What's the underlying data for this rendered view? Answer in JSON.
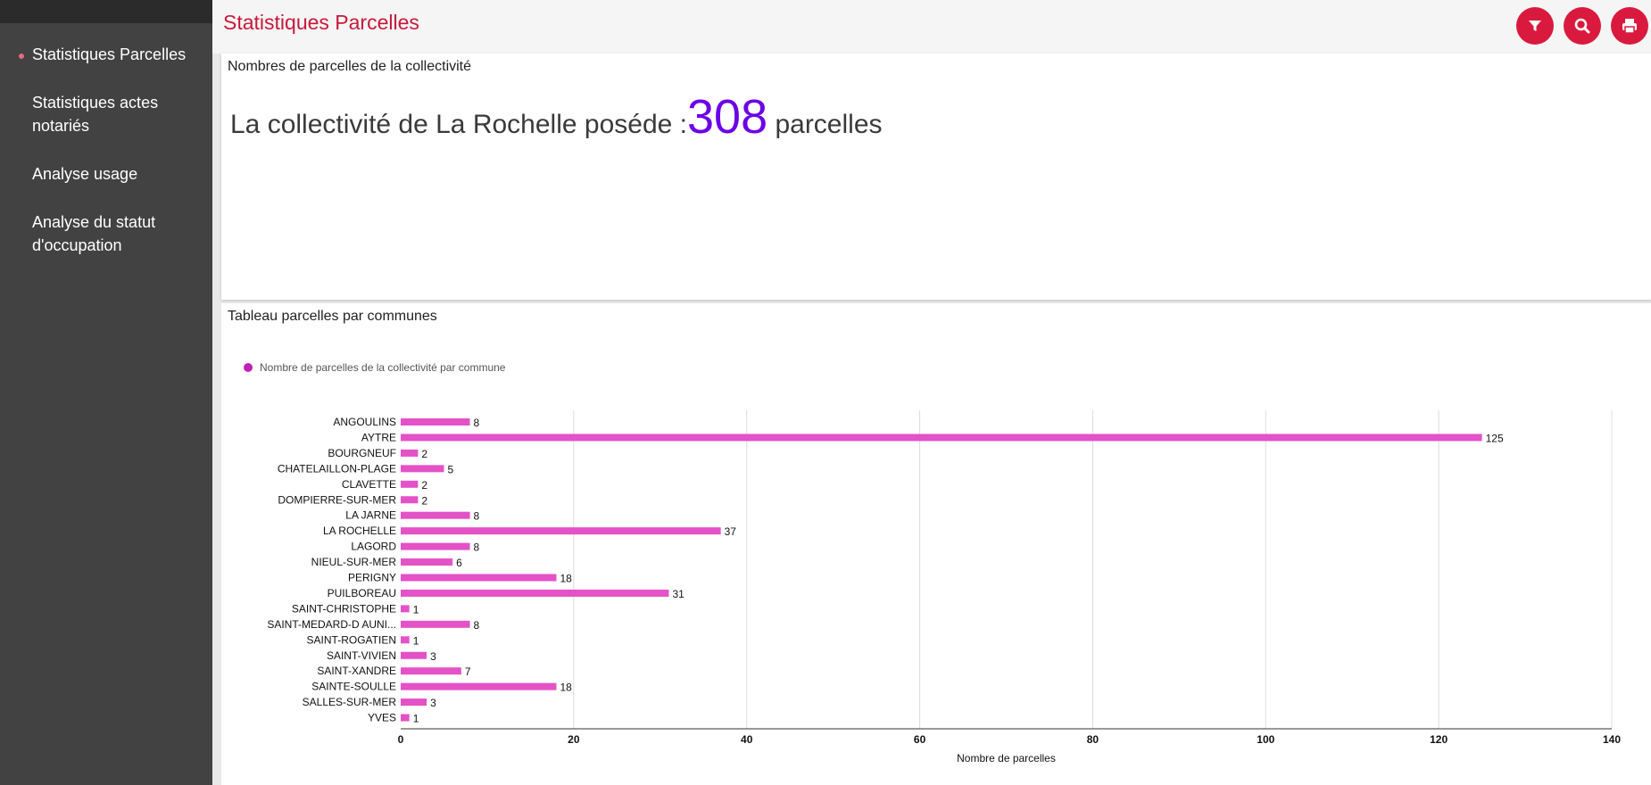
{
  "sidebar": {
    "items": [
      {
        "label": "Statistiques Parcelles",
        "active": true
      },
      {
        "label": "Statistiques actes notariés",
        "active": false
      },
      {
        "label": "Analyse usage",
        "active": false
      },
      {
        "label": "Analyse du statut d'occupation",
        "active": false
      }
    ]
  },
  "header": {
    "title": "Statistiques Parcelles",
    "icons": [
      "filter-icon",
      "search-icon",
      "print-icon"
    ]
  },
  "card_count": {
    "title": "Nombres de parcelles de la collectivité",
    "prefix": "La collectivité de La Rochelle poséde :",
    "count": "308",
    "suffix": " parcelles"
  },
  "card_table": {
    "title": "Tableau parcelles par communes"
  },
  "colors": {
    "accent": "#c8193c",
    "button": "#d91a3e",
    "bar": "#e452c7",
    "count": "#6b00e6",
    "legend_dot": "#c21fb3"
  },
  "chart_data": {
    "type": "bar",
    "orientation": "horizontal",
    "legend": "Nombre de parcelles de la collectivité par commune",
    "legend_position": "top-left",
    "xlabel": "Nombre de parcelles",
    "xlim": [
      0,
      140
    ],
    "xticks": [
      0,
      20,
      40,
      60,
      80,
      100,
      120,
      140
    ],
    "grid": true,
    "categories": [
      "ANGOULINS",
      "AYTRE",
      "BOURGNEUF",
      "CHATELAILLON-PLAGE",
      "CLAVETTE",
      "DOMPIERRE-SUR-MER",
      "LA JARNE",
      "LA ROCHELLE",
      "LAGORD",
      "NIEUL-SUR-MER",
      "PERIGNY",
      "PUILBOREAU",
      "SAINT-CHRISTOPHE",
      "SAINT-MEDARD-D AUNI...",
      "SAINT-ROGATIEN",
      "SAINT-VIVIEN",
      "SAINT-XANDRE",
      "SAINTE-SOULLE",
      "SALLES-SUR-MER",
      "YVES"
    ],
    "values": [
      8,
      125,
      2,
      5,
      2,
      2,
      8,
      37,
      8,
      6,
      18,
      31,
      1,
      8,
      1,
      3,
      7,
      18,
      3,
      1
    ]
  }
}
